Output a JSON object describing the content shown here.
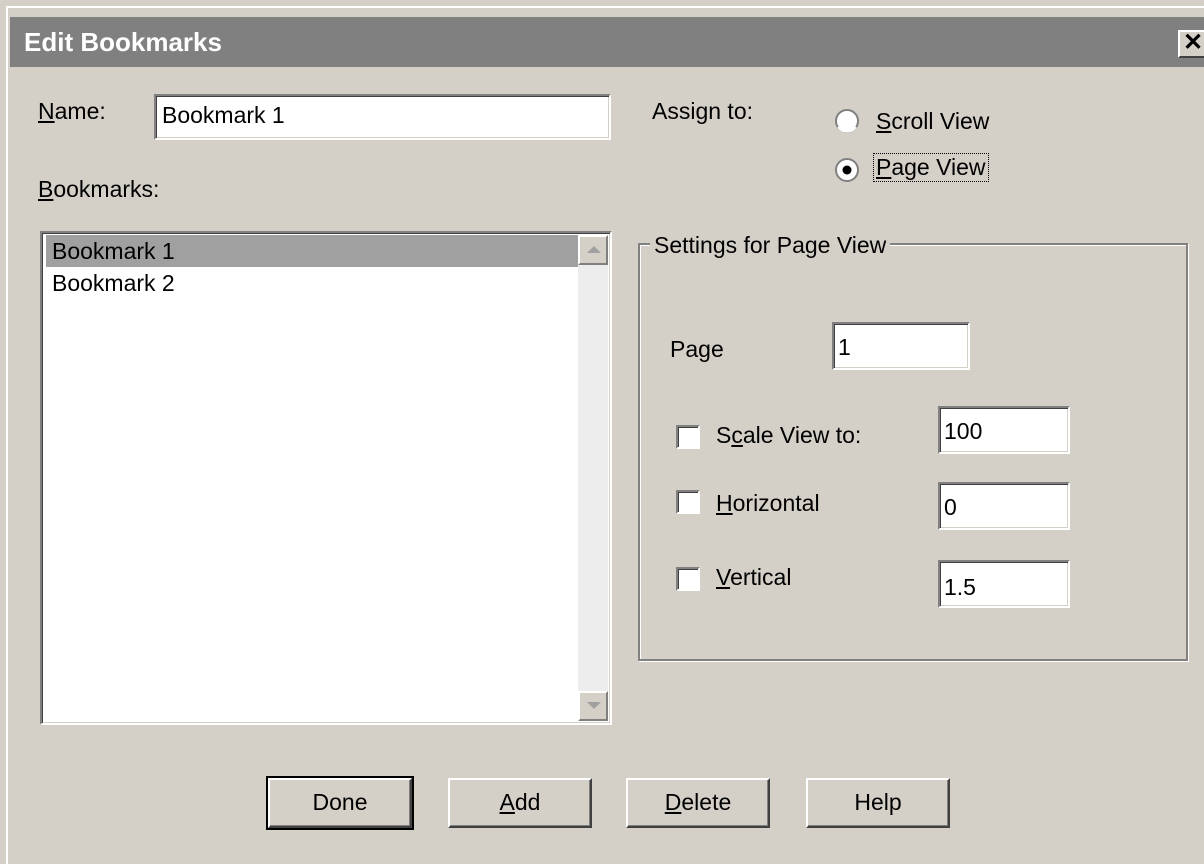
{
  "window": {
    "title": "Edit Bookmarks",
    "close_glyph": "✕",
    "close_icon": "close-icon"
  },
  "name_field": {
    "label_u": "N",
    "label_rest": "ame:",
    "value": "Bookmark  1"
  },
  "bookmarks": {
    "label_u": "B",
    "label_rest": "ookmarks:",
    "items": [
      {
        "label": "Bookmark  1",
        "selected": true
      },
      {
        "label": "Bookmark  2",
        "selected": false
      }
    ]
  },
  "assign_to": {
    "label": "Assign to:",
    "options": [
      {
        "label_u": "S",
        "label_rest": "croll View",
        "selected": false
      },
      {
        "label_u": "P",
        "label_rest": "age View",
        "selected": true
      }
    ]
  },
  "settings": {
    "title": "Settings for Page View",
    "page": {
      "label_pre": "Pa",
      "label_u": "g",
      "label_rest": "e",
      "value": "1"
    },
    "scale": {
      "label_pre": "S",
      "label_u": "c",
      "label_rest": "ale View to:",
      "value": "100",
      "checked": false
    },
    "horizontal": {
      "label_u": "H",
      "label_rest": "orizontal",
      "value": "0",
      "checked": false
    },
    "vertical": {
      "label_u": "V",
      "label_rest": "ertical",
      "value": "1.5",
      "checked": false
    }
  },
  "buttons": {
    "done": {
      "label": "Done"
    },
    "add": {
      "label_u": "A",
      "label_rest": "dd"
    },
    "delete": {
      "label_u": "D",
      "label_rest": "elete"
    },
    "help": {
      "label": "Help"
    }
  }
}
